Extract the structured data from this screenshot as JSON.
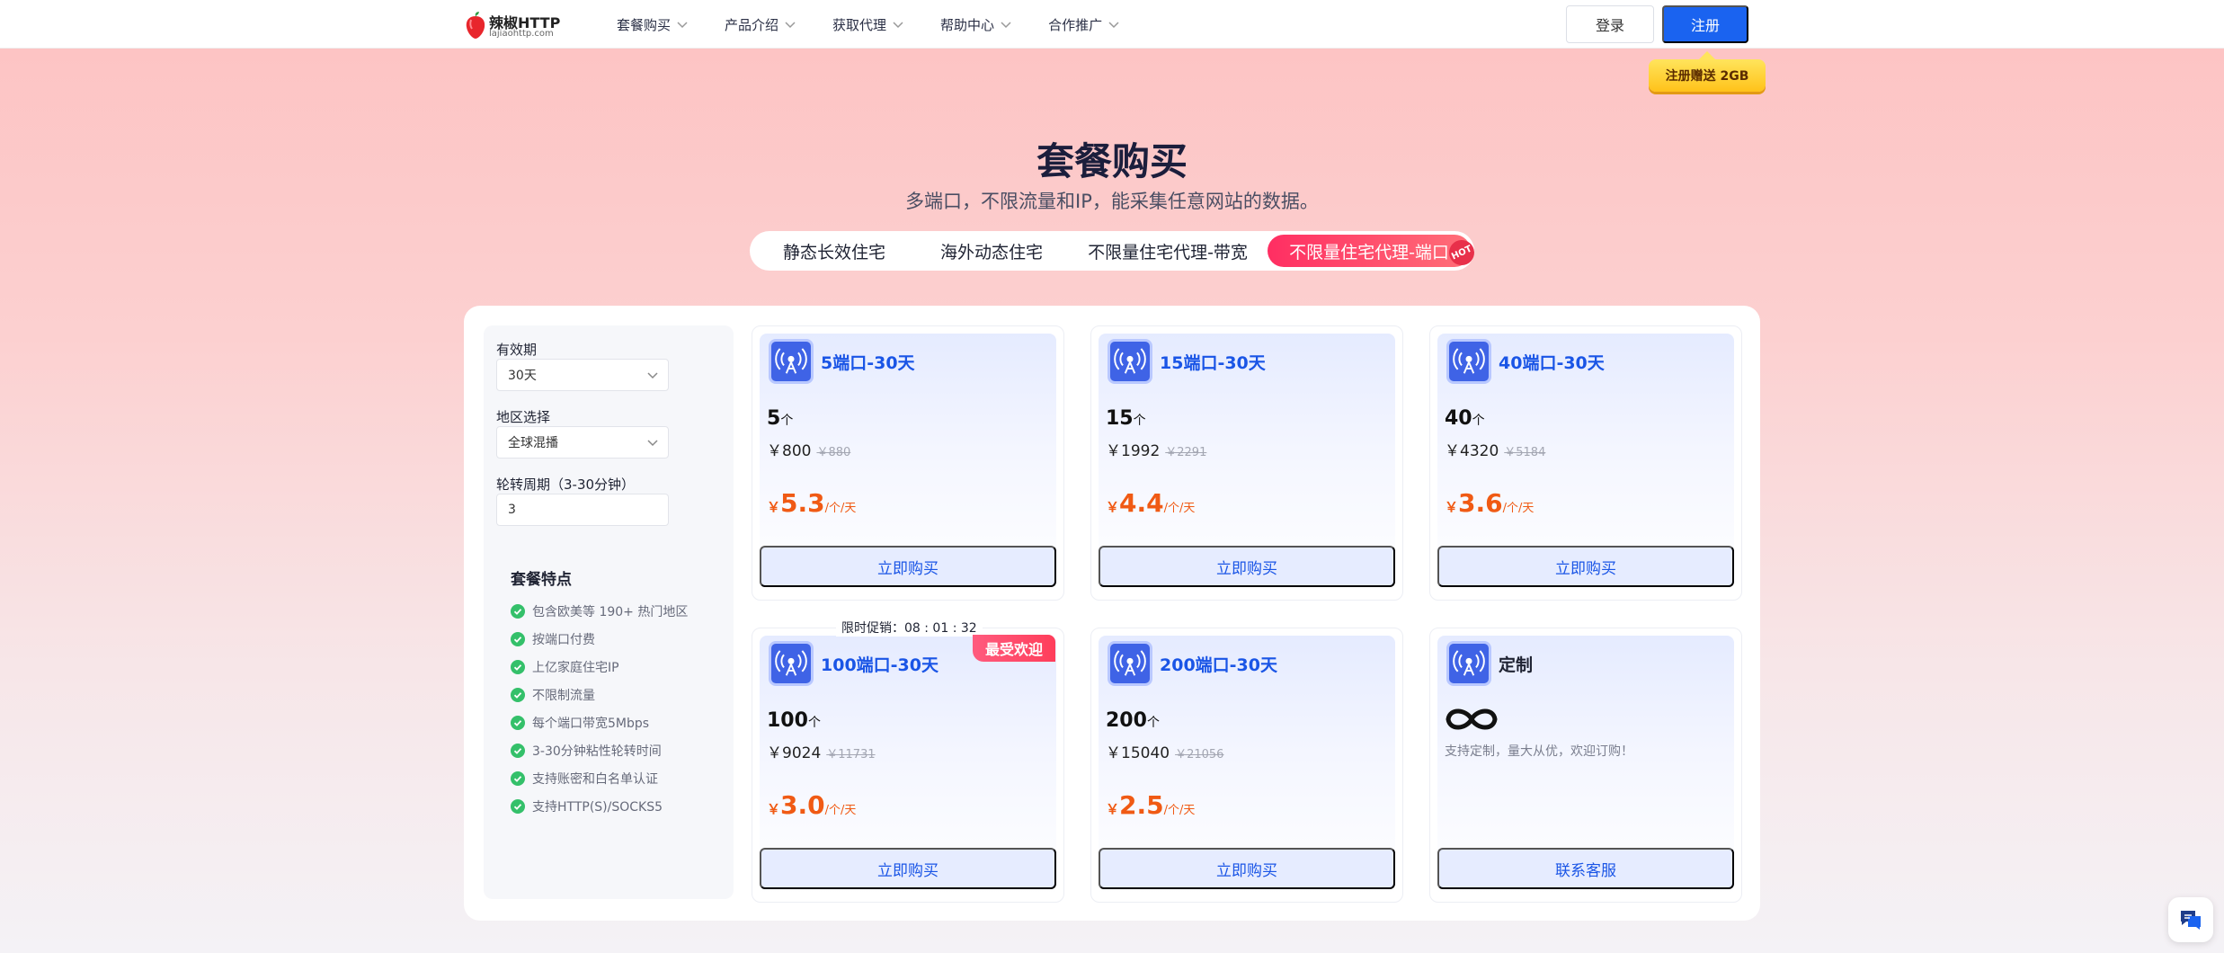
{
  "header": {
    "logo_name": "辣椒HTTP",
    "logo_sub": "lajiaohttp.com",
    "nav": [
      "套餐购买",
      "产品介绍",
      "获取代理",
      "帮助中心",
      "合作推广"
    ],
    "login_label": "登录",
    "register_label": "注册",
    "register_badge": "注册赠送 2GB"
  },
  "hero": {
    "title": "套餐购买",
    "subtitle": "多端口，不限流量和IP，能采集任意网站的数据。"
  },
  "tabs": [
    {
      "label": "静态长效住宅",
      "active": false
    },
    {
      "label": "海外动态住宅",
      "active": false
    },
    {
      "label": "不限量住宅代理-带宽",
      "active": false
    },
    {
      "label": "不限量住宅代理-端口",
      "active": true,
      "badge": "HOT"
    }
  ],
  "sidebar": {
    "validity_label": "有效期",
    "validity_value": "30天",
    "region_label": "地区选择",
    "region_value": "全球混播",
    "rotation_label": "轮转周期（3-30分钟）",
    "rotation_value": "3",
    "features_title": "套餐特点",
    "features": [
      "包含欧美等 190+ 热门地区",
      "按端口付费",
      "上亿家庭住宅IP",
      "不限制流量",
      "每个端口带宽5Mbps",
      "3-30分钟粘性轮转时间",
      "支持账密和白名单认证",
      "支持HTTP(S)/SOCKS5"
    ]
  },
  "cards": [
    {
      "title": "5端口-30天",
      "qty": "5",
      "qty_unit": "个",
      "price": "￥800",
      "orig": "￥880",
      "unit_cur": "￥",
      "unit_price": "5.3",
      "unit_per": "/个/天",
      "button": "立即购买"
    },
    {
      "title": "15端口-30天",
      "qty": "15",
      "qty_unit": "个",
      "price": "￥1992",
      "orig": "￥2291",
      "unit_cur": "￥",
      "unit_price": "4.4",
      "unit_per": "/个/天",
      "button": "立即购买"
    },
    {
      "title": "40端口-30天",
      "qty": "40",
      "qty_unit": "个",
      "price": "￥4320",
      "orig": "￥5184",
      "unit_cur": "￥",
      "unit_price": "3.6",
      "unit_per": "/个/天",
      "button": "立即购买"
    },
    {
      "title": "100端口-30天",
      "qty": "100",
      "qty_unit": "个",
      "price": "￥9024",
      "orig": "￥11731",
      "unit_cur": "￥",
      "unit_price": "3.0",
      "unit_per": "/个/天",
      "button": "立即购买",
      "promo": "限时促销：08 : 01 : 32",
      "popular": "最受欢迎"
    },
    {
      "title": "200端口-30天",
      "qty": "200",
      "qty_unit": "个",
      "price": "￥15040",
      "orig": "￥21056",
      "unit_cur": "￥",
      "unit_price": "2.5",
      "unit_per": "/个/天",
      "button": "立即购买"
    },
    {
      "title": "定制",
      "custom_text": "支持定制，量大从优，欢迎订购！",
      "button": "联系客服"
    }
  ],
  "colors": {
    "accent_blue": "#1a63f0",
    "price_orange": "#f05a14",
    "tab_active": "#ff2e62"
  },
  "icons": [
    "chevron-down-icon",
    "antenna-icon",
    "check-circle-icon",
    "infinity-icon",
    "chat-icon"
  ]
}
